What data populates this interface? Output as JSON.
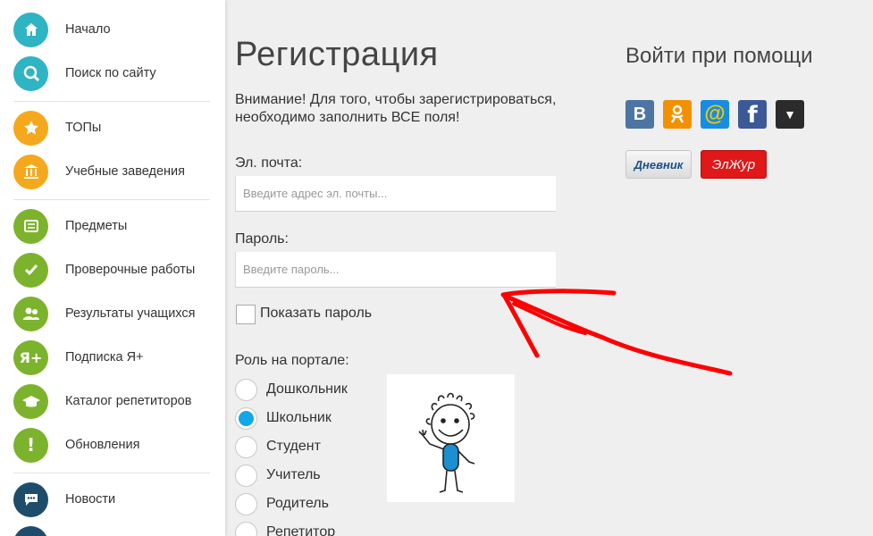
{
  "sidebar": {
    "items": [
      {
        "label": "Начало",
        "color": "#2fb4c4",
        "icon": "home-icon"
      },
      {
        "label": "Поиск по сайту",
        "color": "#2fb4c4",
        "icon": "search-icon"
      },
      {
        "label": "ТОПы",
        "color": "#f5a81b",
        "icon": "star-icon"
      },
      {
        "label": "Учебные заведения",
        "color": "#f5a81b",
        "icon": "institution-icon"
      },
      {
        "label": "Предметы",
        "color": "#7cb32c",
        "icon": "list-icon"
      },
      {
        "label": "Проверочные работы",
        "color": "#7cb32c",
        "icon": "check-icon"
      },
      {
        "label": "Результаты учащихся",
        "color": "#7cb32c",
        "icon": "users-icon"
      },
      {
        "label": "Подписка Я+",
        "color": "#7cb32c",
        "icon": "ya-plus-icon",
        "glyph": "Я+"
      },
      {
        "label": "Каталог репетиторов",
        "color": "#7cb32c",
        "icon": "graduation-cap-icon"
      },
      {
        "label": "Обновления",
        "color": "#7cb32c",
        "icon": "exclamation-icon",
        "glyph": "!"
      },
      {
        "label": "Новости",
        "color": "#1d4d6b",
        "icon": "chat-icon"
      }
    ]
  },
  "form": {
    "title": "Регистрация",
    "notice": "Внимание! Для того, чтобы зарегистрироваться, необходимо заполнить ВСЕ поля!",
    "email_label": "Эл. почта:",
    "email_placeholder": "Введите адрес эл. почты...",
    "password_label": "Пароль:",
    "password_placeholder": "Введите пароль...",
    "show_password": "Показать пароль",
    "role_label": "Роль на портале:",
    "roles": [
      {
        "label": "Дошкольник",
        "checked": false
      },
      {
        "label": "Школьник",
        "checked": true
      },
      {
        "label": "Студент",
        "checked": false
      },
      {
        "label": "Учитель",
        "checked": false
      },
      {
        "label": "Родитель",
        "checked": false
      },
      {
        "label": "Репетитор",
        "checked": false
      }
    ]
  },
  "social": {
    "title": "Войти при помощи",
    "buttons": [
      {
        "glyph": "В",
        "color": "#4c75a3",
        "icon": "vk-icon"
      },
      {
        "glyph": "ok",
        "color": "#f29100",
        "icon": "odnoklassniki-icon"
      },
      {
        "glyph": "@",
        "color": "#168de2",
        "icon": "mail-ru-icon"
      },
      {
        "glyph": "f",
        "color": "#3b5998",
        "icon": "facebook-icon"
      },
      {
        "glyph": "▼",
        "color": "#2b2b2b",
        "icon": "more-icon"
      }
    ],
    "dnevnik_label": "Дневник",
    "elzhur_label": "ЭлЖур"
  },
  "colors": {
    "accent_radio": "#11a8e8",
    "annotation_arrow": "#ff0000"
  }
}
